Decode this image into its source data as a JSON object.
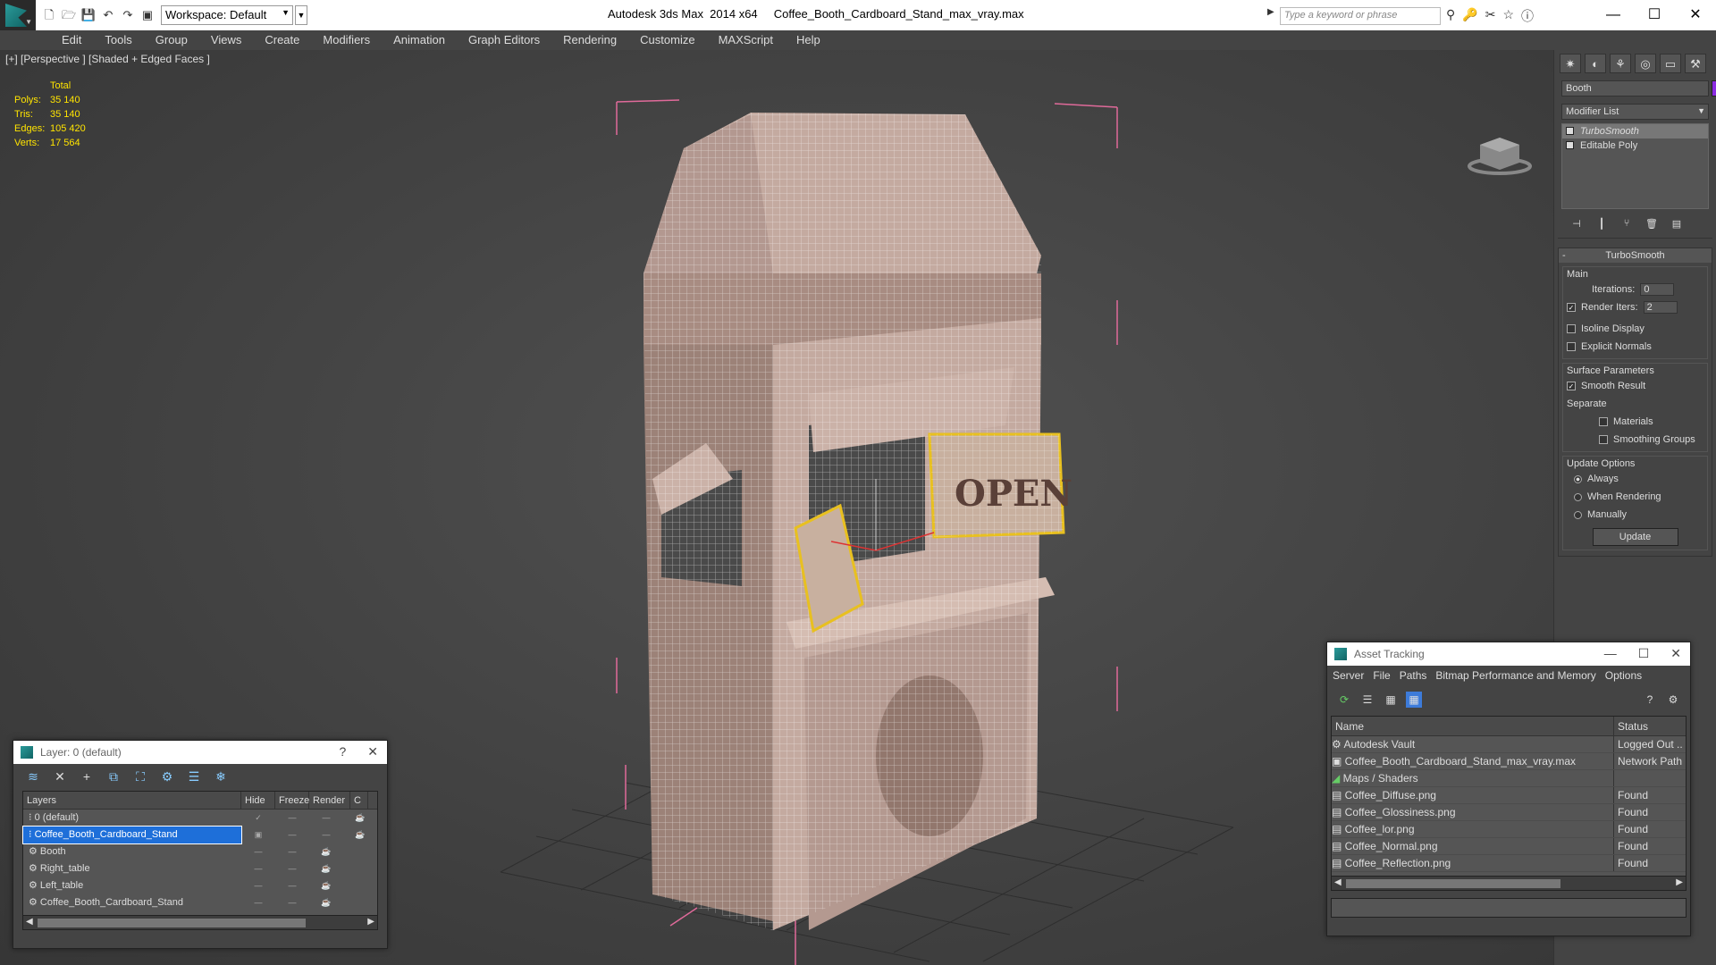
{
  "titlebar": {
    "workspace": "Workspace: Default",
    "app_title": "Autodesk 3ds Max  2014 x64     Coffee_Booth_Cardboard_Stand_max_vray.max",
    "search_placeholder": "Type a keyword or phrase"
  },
  "menu": [
    "Edit",
    "Tools",
    "Group",
    "Views",
    "Create",
    "Modifiers",
    "Animation",
    "Graph Editors",
    "Rendering",
    "Customize",
    "MAXScript",
    "Help"
  ],
  "viewport": {
    "label": "[+] [Perspective ] [Shaded + Edged Faces ]",
    "stats": {
      "header": "Total",
      "polys_k": "Polys:",
      "polys": "35 140",
      "tris_k": "Tris:",
      "tris": "35 140",
      "edges_k": "Edges:",
      "edges": "105 420",
      "verts_k": "Verts:",
      "verts": "17 564"
    },
    "sign_text": "OPEN"
  },
  "command_panel": {
    "object_name": "Booth",
    "object_color": "#8a2be2",
    "modifier_list": "Modifier List",
    "stack": [
      "TurboSmooth",
      "Editable Poly"
    ],
    "rollout_title": "TurboSmooth",
    "main_group": "Main",
    "iterations_label": "Iterations:",
    "iterations": "0",
    "render_iters_label": "Render Iters:",
    "render_iters": "2",
    "isoline": "Isoline Display",
    "explicit_normals": "Explicit Normals",
    "surface_group": "Surface Parameters",
    "smooth_result": "Smooth Result",
    "separate": "Separate",
    "materials": "Materials",
    "smoothing_groups": "Smoothing Groups",
    "update_group": "Update Options",
    "always": "Always",
    "when_rendering": "When Rendering",
    "manually": "Manually",
    "update_button": "Update"
  },
  "layers_dialog": {
    "title": "Layer: 0 (default)",
    "help": "?",
    "columns": [
      "Layers",
      "Hide",
      "Freeze",
      "Render",
      "C"
    ],
    "rows": [
      {
        "name": "0 (default)",
        "indent": "    "
      },
      {
        "name": "Coffee_Booth_Cardboard_Stand",
        "indent": "    "
      },
      {
        "name": "Booth",
        "indent": "        "
      },
      {
        "name": "Right_table",
        "indent": "        "
      },
      {
        "name": "Left_table",
        "indent": "        "
      },
      {
        "name": "Coffee_Booth_Cardboard_Stand",
        "indent": "        "
      }
    ]
  },
  "asset_dialog": {
    "title": "Asset Tracking",
    "menu": [
      "Server",
      "File",
      "Paths",
      "Bitmap Performance and Memory",
      "Options"
    ],
    "columns": [
      "Name",
      "Status"
    ],
    "rows": [
      {
        "name": "Autodesk Vault",
        "status": "Logged Out ..",
        "indent": "     "
      },
      {
        "name": "Coffee_Booth_Cardboard_Stand_max_vray.max",
        "status": "Network Path",
        "indent": "         "
      },
      {
        "name": "Maps / Shaders",
        "status": "",
        "indent": "             "
      },
      {
        "name": "Coffee_Diffuse.png",
        "status": "Found",
        "indent": "                 "
      },
      {
        "name": "Coffee_Glossiness.png",
        "status": "Found",
        "indent": "                 "
      },
      {
        "name": "Coffee_lor.png",
        "status": "Found",
        "indent": "                 "
      },
      {
        "name": "Coffee_Normal.png",
        "status": "Found",
        "indent": "                 "
      },
      {
        "name": "Coffee_Reflection.png",
        "status": "Found",
        "indent": "                 "
      }
    ]
  }
}
